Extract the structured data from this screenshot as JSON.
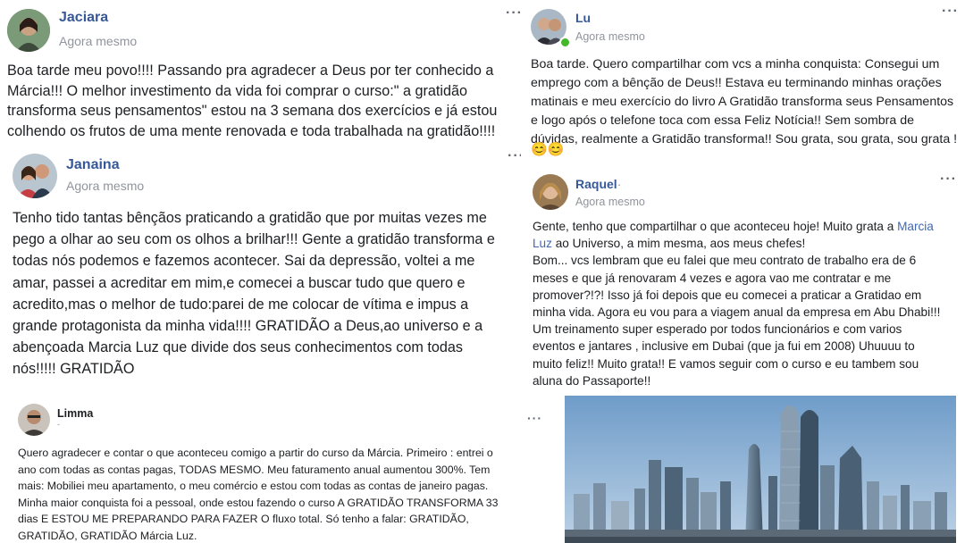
{
  "posts": [
    {
      "author": "Jaciara",
      "time": "Agora mesmo",
      "more": "···",
      "text": "Boa tarde meu povo!!!! Passando pra agradecer a Deus por ter conhecido a\nMárcia!!! O melhor investimento da vida foi comprar o curso:\" a gratidão\ntransforma seus pensamentos\" estou na 3 semana dos exercícios e já estou\ncolhendo os frutos de uma mente renovada e toda trabalhada na gratidão!!!!"
    },
    {
      "author": "Lu",
      "time": "Agora mesmo",
      "more": "···",
      "text": "Boa tarde. Quero compartilhar com vcs a minha conquista: Consegui um\nemprego com a bênção de Deus!! Estava eu terminando minhas orações\nmatinais e meu exercício do livro A Gratidão transforma seus Pensamentos\ne logo após o telefone toca com essa Feliz Notícia!! Sem sombra de\ndúvidas, realmente a Gratidão transforma!! Sou grata, sou grata, sou grata !",
      "emoji": "😊😊"
    },
    {
      "author": "Janaina",
      "time": "Agora mesmo",
      "more": "···",
      "text": "Tenho tido tantas bênçãos praticando a gratidão que por muitas vezes me\npego a olhar ao seu com os olhos a brilhar!!! Gente a gratidão transforma e\ntodas nós podemos e fazemos acontecer. Sai da depressão, voltei a me\namar, passei a acreditar em mim,e comecei a buscar tudo que quero e\nacredito,mas o melhor de tudo:parei de me colocar de vítima e impus a\ngrande protagonista da minha vida!!!! GRATIDÃO a Deus,ao universo e a\nabençoada Marcia Luz que divide dos seus conhecimentos com todas\nnós!!!!! GRATIDÃO"
    },
    {
      "author": "Raquel",
      "author_suffix": "·",
      "time": "Agora mesmo",
      "more": "···",
      "text_a": "Gente, tenho que compartilhar o que aconteceu hoje! Muito grata a ",
      "link1": "Marcia",
      "link2": "Luz",
      "text_b": " ao Universo, a mim mesma, aos meus chefes!\nBom... vcs lembram que eu falei que meu contrato de trabalho era de 6\nmeses e que já renovaram 4 vezes e agora vao me contratar e me\npromover?!?! Isso já foi depois que eu comecei a praticar a Gratidao em\nminha vida. Agora eu vou para a viagem anual da empresa em Abu Dhabi!!!\nUm treinamento super esperado por todos funcionários e com varios\neventos e jantares , inclusive em Dubai (que ja fui em 2008) Uhuuuu to\nmuito feliz!! Muito grata!! E vamos seguir com o curso e eu tambem sou\naluna do Passaporte!!"
    },
    {
      "author": "Limma",
      "time": "-",
      "more": "···",
      "text": "Quero agradecer e contar o que aconteceu comigo a partir do curso da Márcia. Primeiro : entrei o\nano com todas as contas pagas, TODAS MESMO. Meu faturamento anual aumentou 300%. Tem\nmais: Mobiliei meu apartamento, o meu comércio e estou com todas as contas de janeiro pagas.\nMinha maior conquista foi a pessoal, onde estou fazendo o curso A GRATIDÃO TRANSFORMA 33\ndias E ESTOU ME PREPARANDO PARA FAZER O fluxo total. Só tenho a falar: GRATIDÃO,\nGRATIDÃO, GRATIDÃO Márcia Luz."
    }
  ],
  "colors": {
    "name": "#365899",
    "time": "#90949c",
    "link": "#4267b2",
    "sky": "#8fb3d6",
    "water": "#6f8fb0"
  }
}
